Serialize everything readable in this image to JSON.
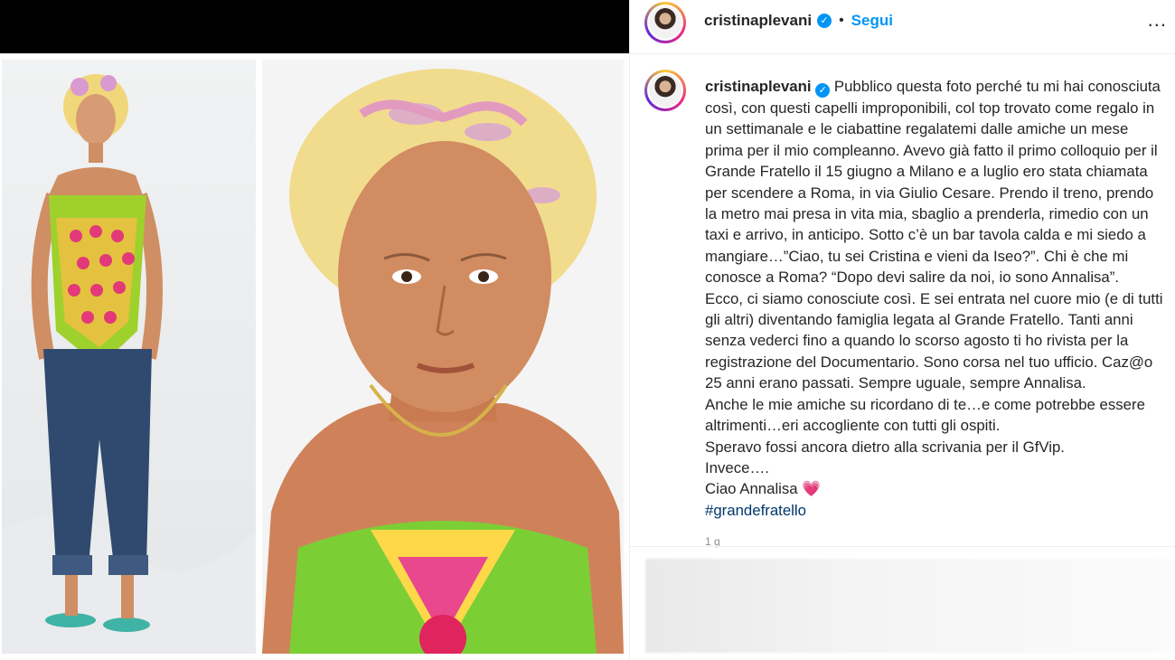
{
  "post": {
    "username": "cristinaplevani",
    "follow_label": "Segui",
    "more_label": "...",
    "caption_lines": [
      "Pubblico questa foto perché tu mi hai conosciuta così, con questi capelli improponibili, col top trovato come regalo in un settimanale e le ciabattine regalatemi dalle amiche un mese prima per il mio compleanno. Avevo già fatto il primo colloquio per il Grande Fratello il 15 giugno a Milano e a luglio ero stata chiamata per scendere a Roma, in via Giulio Cesare. Prendo il treno, prendo la metro mai presa in vita mia, sbaglio a prenderla, rimedio con un taxi e arrivo, in anticipo. Sotto c’è un bar tavola calda e mi siedo a mangiare…”Ciao, tu sei Cristina e vieni da Iseo?”. Chi è che mi conosce a Roma? “Dopo devi salire da noi, io sono Annalisa”.",
      "Ecco, ci siamo conosciute così. E sei entrata nel cuore mio (e di tutti gli altri) diventando famiglia legata al Grande Fratello. Tanti anni senza vederci fino a quando lo scorso agosto ti ho rivista per la registrazione del Documentario. Sono corsa nel tuo ufficio. Caz@o 25 anni erano passati. Sempre uguale, sempre Annalisa.",
      "Anche le mie amiche su ricordano di te…e come potrebbe essere altrimenti…eri accogliente con tutti gli ospiti.",
      "Speravo fossi ancora dietro alla scrivania per il GfVip.",
      "Invece….",
      "Ciao Annalisa"
    ],
    "heart_emoji": "💗",
    "hashtag": "#grandefratello",
    "time_ago": "1 g"
  },
  "colors": {
    "link_blue": "#0095f6",
    "hashtag": "#00376b",
    "heart": "#ed2e6b"
  }
}
